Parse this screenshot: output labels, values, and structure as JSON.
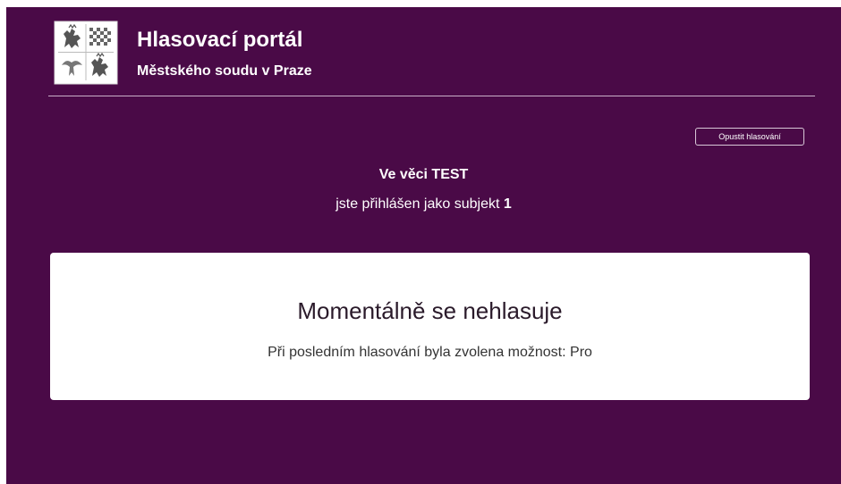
{
  "header": {
    "title": "Hlasovací portál",
    "subtitle": "Městského soudu v Praze",
    "logo_icon": "czech-coat-of-arms-icon"
  },
  "toolbar": {
    "leave_voting_label": "Opustit hlasování"
  },
  "session": {
    "case_prefix": "Ve věci",
    "case_name": "TEST",
    "login_prefix": "jste přihlášen jako subjekt",
    "subject_number": "1"
  },
  "status_card": {
    "title": "Momentálně se nehlasuje",
    "last_vote_text": "Při posledním hlasování byla zvolena možnost: Pro"
  },
  "colors": {
    "background": "#4a0a47",
    "card": "#ffffff",
    "text_on_dark": "#ffffff"
  }
}
